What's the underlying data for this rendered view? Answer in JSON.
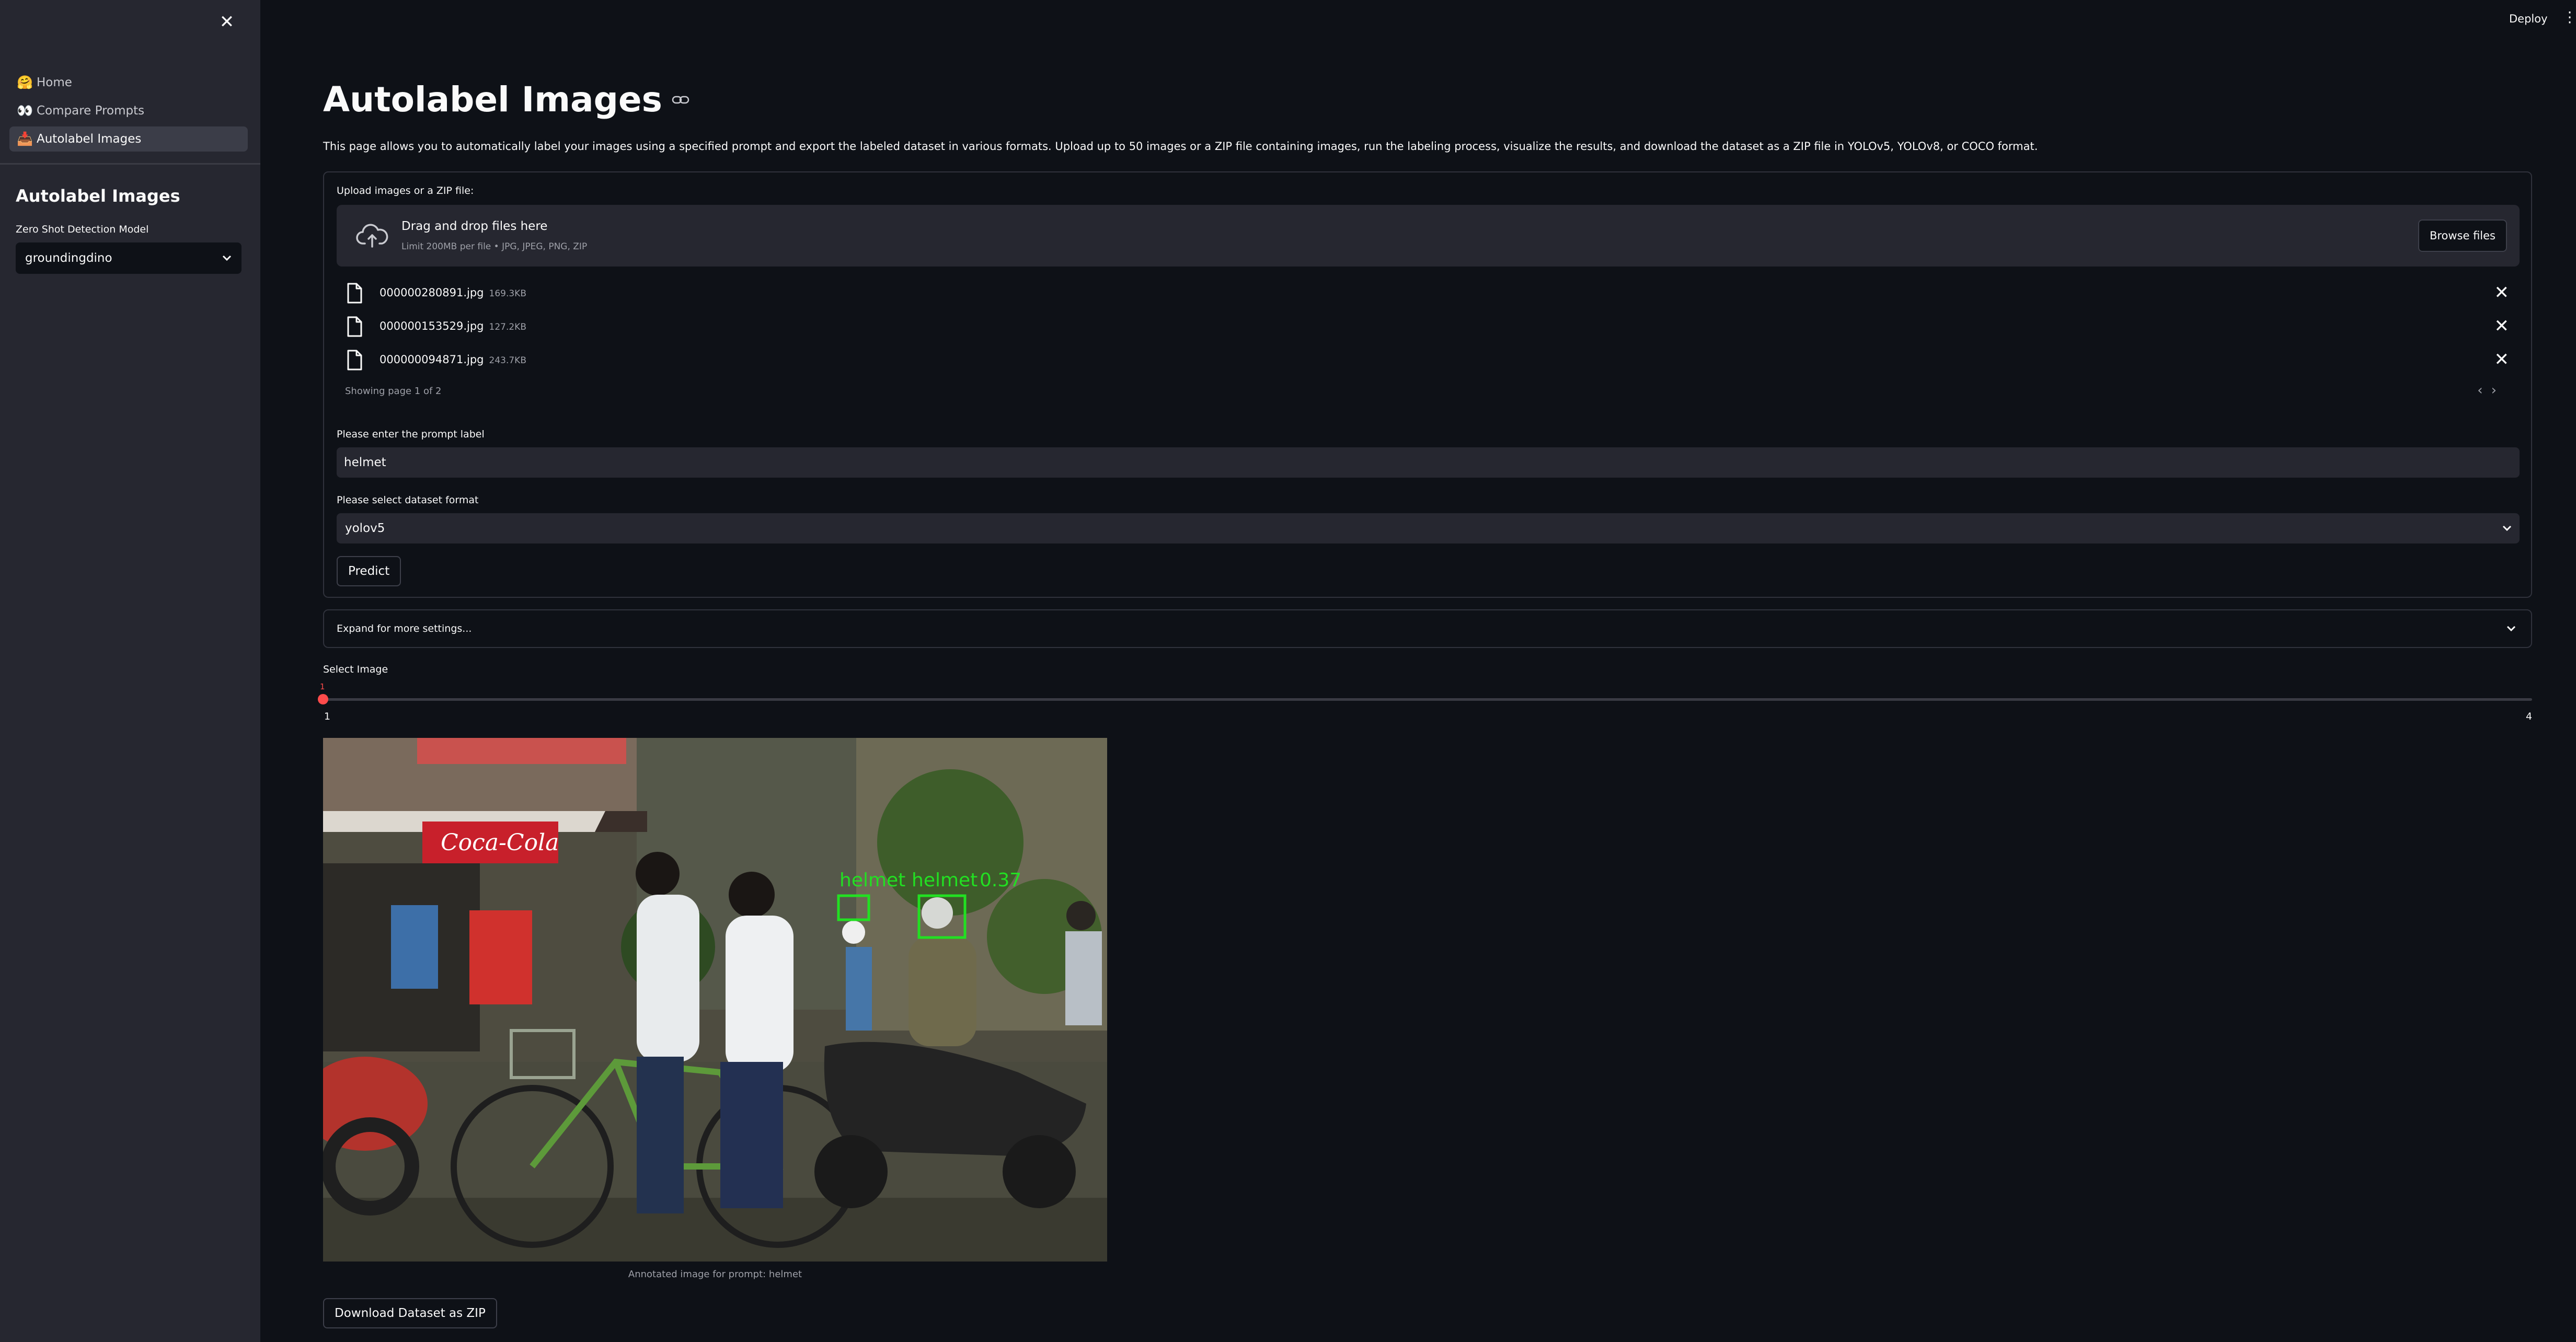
{
  "sidebar": {
    "close_symbol": "✕",
    "nav": [
      {
        "emoji": "🤗",
        "label": "Home",
        "active": false
      },
      {
        "emoji": "👀",
        "label": "Compare Prompts",
        "active": false
      },
      {
        "emoji": "📥",
        "label": "Autolabel Images",
        "active": true
      }
    ],
    "title": "Autolabel Images",
    "model_label": "Zero Shot Detection Model",
    "model_value": "groundingdino"
  },
  "header": {
    "deploy": "Deploy",
    "menu_symbol": "⋮"
  },
  "main": {
    "title": "Autolabel Images",
    "link_symbol": "⛓",
    "description": "This page allows you to automatically label your images using a specified prompt and export the labeled dataset in various formats. Upload up to 50 images or a ZIP file containing images, run the labeling process, visualize the results, and download the dataset as a ZIP file in YOLOv5, YOLOv8, or COCO format.",
    "uploader": {
      "label": "Upload images or a ZIP file:",
      "drop_text": "Drag and drop files here",
      "limit_text": "Limit 200MB per file • JPG, JPEG, PNG, ZIP",
      "browse_label": "Browse files",
      "files": [
        {
          "name": "000000280891.jpg",
          "size": "169.3KB"
        },
        {
          "name": "000000153529.jpg",
          "size": "127.2KB"
        },
        {
          "name": "000000094871.jpg",
          "size": "243.7KB"
        }
      ],
      "remove_symbol": "✕",
      "page_info": "Showing page 1 of 2",
      "prev_symbol": "‹",
      "next_symbol": "›"
    },
    "prompt": {
      "label": "Please enter the prompt label",
      "value": "helmet"
    },
    "format": {
      "label": "Please select dataset format",
      "value": "yolov5"
    },
    "predict_label": "Predict",
    "expander_label": "Expand for more settings...",
    "slider": {
      "label": "Select Image",
      "min": 1,
      "max": 4,
      "value": 1
    },
    "image": {
      "detections": [
        {
          "label": "helmet",
          "score": "0.37"
        },
        {
          "label": "helmet",
          "score": ""
        }
      ],
      "sign_text": "Coca-Cola",
      "box_color": "#22e022"
    },
    "caption": "Annotated image for prompt: helmet",
    "download_label": "Download Dataset as ZIP"
  },
  "colors": {
    "background": "#0e1117",
    "sidebar": "#262730",
    "accent": "#ff4b4b",
    "text": "#fafafa"
  }
}
